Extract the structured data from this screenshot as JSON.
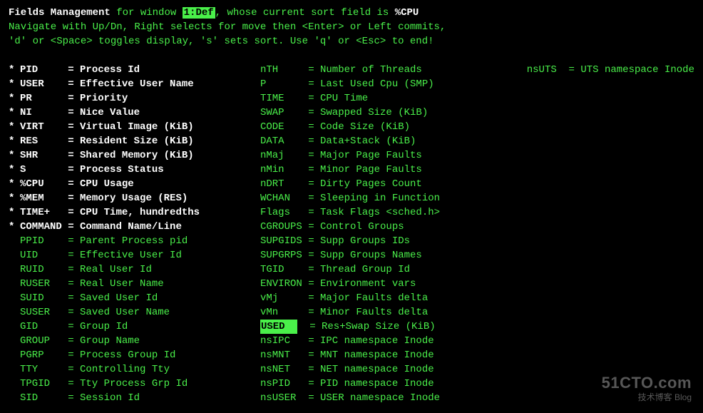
{
  "header": {
    "title": "Fields Management",
    "for_text": " for window ",
    "window": "1:Def",
    "rest": ", whose current sort field is ",
    "sort_field": "%CPU",
    "line2": "   Navigate with Up/Dn, Right selects for move then <Enter> or Left commits,",
    "line3": "   'd' or <Space> toggles display, 's' sets sort.  Use 'q' or <Esc> to end!"
  },
  "layout": {
    "fld_w1": 8,
    "fld_w2": 8,
    "fld_w3": 7
  },
  "col1": [
    {
      "mark": "*",
      "f": "PID",
      "d": "Process Id",
      "on": true
    },
    {
      "mark": "*",
      "f": "USER",
      "d": "Effective User Name",
      "on": true
    },
    {
      "mark": "*",
      "f": "PR",
      "d": "Priority",
      "on": true
    },
    {
      "mark": "*",
      "f": "NI",
      "d": "Nice Value",
      "on": true
    },
    {
      "mark": "*",
      "f": "VIRT",
      "d": "Virtual Image (KiB)",
      "on": true
    },
    {
      "mark": "*",
      "f": "RES",
      "d": "Resident Size (KiB)",
      "on": true
    },
    {
      "mark": "*",
      "f": "SHR",
      "d": "Shared Memory (KiB)",
      "on": true
    },
    {
      "mark": "*",
      "f": "S",
      "d": "Process Status",
      "on": true
    },
    {
      "mark": "*",
      "f": "%CPU",
      "d": "CPU Usage",
      "on": true
    },
    {
      "mark": "*",
      "f": "%MEM",
      "d": "Memory Usage (RES)",
      "on": true
    },
    {
      "mark": "*",
      "f": "TIME+",
      "d": "CPU Time, hundredths",
      "on": true
    },
    {
      "mark": "*",
      "f": "COMMAND",
      "d": "Command Name/Line",
      "on": true
    },
    {
      "mark": "",
      "f": "PPID",
      "d": "Parent Process pid",
      "on": false
    },
    {
      "mark": "",
      "f": "UID",
      "d": "Effective User Id",
      "on": false
    },
    {
      "mark": "",
      "f": "RUID",
      "d": "Real User Id",
      "on": false
    },
    {
      "mark": "",
      "f": "RUSER",
      "d": "Real User Name",
      "on": false
    },
    {
      "mark": "",
      "f": "SUID",
      "d": "Saved User Id",
      "on": false
    },
    {
      "mark": "",
      "f": "SUSER",
      "d": "Saved User Name",
      "on": false
    },
    {
      "mark": "",
      "f": "GID",
      "d": "Group Id",
      "on": false
    },
    {
      "mark": "",
      "f": "GROUP",
      "d": "Group Name",
      "on": false
    },
    {
      "mark": "",
      "f": "PGRP",
      "d": "Process Group Id",
      "on": false
    },
    {
      "mark": "",
      "f": "TTY",
      "d": "Controlling Tty",
      "on": false
    },
    {
      "mark": "",
      "f": "TPGID",
      "d": "Tty Process Grp Id",
      "on": false
    },
    {
      "mark": "",
      "f": "SID",
      "d": "Session Id",
      "on": false
    }
  ],
  "col2": [
    {
      "mark": "",
      "f": "nTH",
      "d": "Number of Threads",
      "on": false
    },
    {
      "mark": "",
      "f": "P",
      "d": "Last Used Cpu (SMP)",
      "on": false
    },
    {
      "mark": "",
      "f": "TIME",
      "d": "CPU Time",
      "on": false
    },
    {
      "mark": "",
      "f": "SWAP",
      "d": "Swapped Size (KiB)",
      "on": false
    },
    {
      "mark": "",
      "f": "CODE",
      "d": "Code Size (KiB)",
      "on": false
    },
    {
      "mark": "",
      "f": "DATA",
      "d": "Data+Stack (KiB)",
      "on": false
    },
    {
      "mark": "",
      "f": "nMaj",
      "d": "Major Page Faults",
      "on": false
    },
    {
      "mark": "",
      "f": "nMin",
      "d": "Minor Page Faults",
      "on": false
    },
    {
      "mark": "",
      "f": "nDRT",
      "d": "Dirty Pages Count",
      "on": false
    },
    {
      "mark": "",
      "f": "WCHAN",
      "d": "Sleeping in Function",
      "on": false
    },
    {
      "mark": "",
      "f": "Flags",
      "d": "Task Flags <sched.h>",
      "on": false
    },
    {
      "mark": "",
      "f": "CGROUPS",
      "d": "Control Groups",
      "on": false
    },
    {
      "mark": "",
      "f": "SUPGIDS",
      "d": "Supp Groups IDs",
      "on": false
    },
    {
      "mark": "",
      "f": "SUPGRPS",
      "d": "Supp Groups Names",
      "on": false
    },
    {
      "mark": "",
      "f": "TGID",
      "d": "Thread Group Id",
      "on": false
    },
    {
      "mark": "",
      "f": "ENVIRON",
      "d": "Environment vars",
      "on": false
    },
    {
      "mark": "",
      "f": "vMj",
      "d": "Major Faults delta",
      "on": false
    },
    {
      "mark": "",
      "f": "vMn",
      "d": "Minor Faults delta",
      "on": false
    },
    {
      "mark": "",
      "f": "USED",
      "d": "Res+Swap Size (KiB)",
      "on": false,
      "sel": true
    },
    {
      "mark": "",
      "f": "nsIPC",
      "d": "IPC namespace Inode",
      "on": false
    },
    {
      "mark": "",
      "f": "nsMNT",
      "d": "MNT namespace Inode",
      "on": false
    },
    {
      "mark": "",
      "f": "nsNET",
      "d": "NET namespace Inode",
      "on": false
    },
    {
      "mark": "",
      "f": "nsPID",
      "d": "PID namespace Inode",
      "on": false
    },
    {
      "mark": "",
      "f": "nsUSER",
      "d": "USER namespace Inode",
      "on": false
    }
  ],
  "col3": [
    {
      "mark": "",
      "f": "nsUTS",
      "d": "UTS namespace Inode",
      "on": false
    }
  ],
  "watermark": {
    "big": "51CTO.com",
    "small": "技术博客          Blog"
  }
}
